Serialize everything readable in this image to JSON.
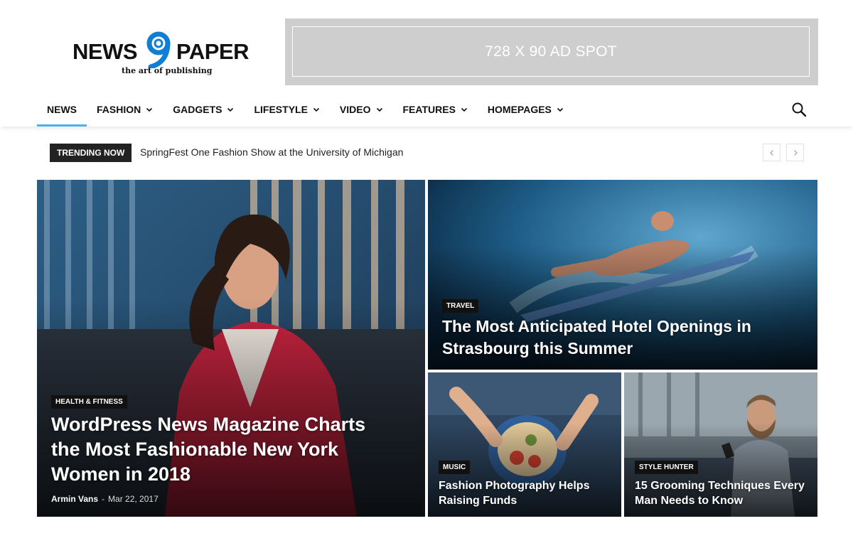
{
  "logo": {
    "word_left": "NEWS",
    "word_right": "PAPER",
    "tagline": "the art of publishing",
    "accent_color": "#0f7fd4"
  },
  "ad": {
    "text": "728 X 90 AD SPOT"
  },
  "nav": {
    "items": [
      {
        "label": "NEWS",
        "dropdown": false,
        "active": true
      },
      {
        "label": "FASHION",
        "dropdown": true
      },
      {
        "label": "GADGETS",
        "dropdown": true
      },
      {
        "label": "LIFESTYLE",
        "dropdown": true
      },
      {
        "label": "VIDEO",
        "dropdown": true
      },
      {
        "label": "FEATURES",
        "dropdown": true
      },
      {
        "label": "HOMEPAGES",
        "dropdown": true
      }
    ],
    "active_color": "#4db2ec",
    "search_icon": "search-icon"
  },
  "trending": {
    "label": "TRENDING NOW",
    "headline": "SpringFest One Fashion Show at the University of Michigan",
    "prev_icon": "chevron-left-icon",
    "next_icon": "chevron-right-icon"
  },
  "featured": {
    "main": {
      "category": "HEALTH & FITNESS",
      "title": "WordPress News Magazine Charts the Most Fashionable New York Women in 2018",
      "author": "Armin Vans",
      "separator": "-",
      "date": "Mar 22, 2017"
    },
    "top_right": {
      "category": "TRAVEL",
      "title": "The Most Anticipated Hotel Openings in Strasbourg this Summer"
    },
    "bottom_left": {
      "category": "MUSIC",
      "title": "Fashion Photography Helps Raising Funds"
    },
    "bottom_right": {
      "category": "STYLE HUNTER",
      "title": "15 Grooming Techniques Every Man Needs to Know"
    }
  }
}
